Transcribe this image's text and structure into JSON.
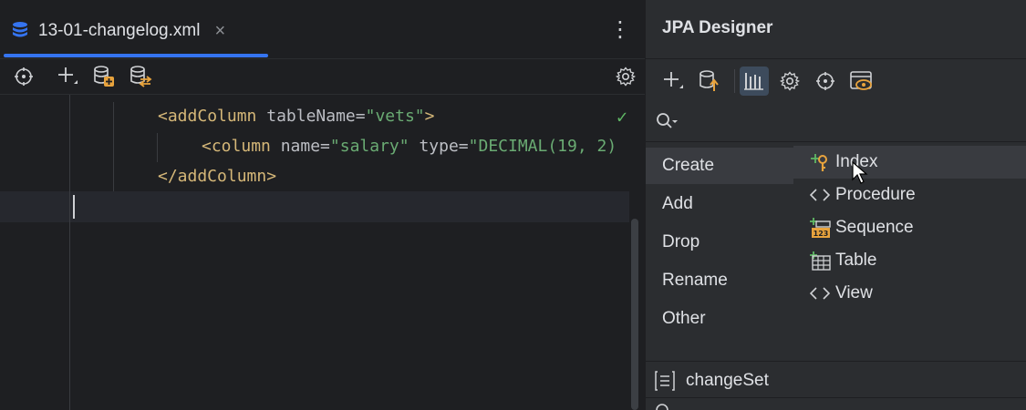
{
  "editor": {
    "tab": {
      "label": "13-01-changelog.xml",
      "close": "×"
    },
    "more_glyph": "⋮",
    "code": {
      "line1": {
        "open": "<",
        "tag": "addColumn",
        "attr": " tableName=",
        "val": "\"vets\"",
        "close": ">"
      },
      "line2": {
        "open": "<",
        "tag": "column",
        "attr1": " name=",
        "val1": "\"salary\"",
        "attr2": " type=",
        "val2": "\"DECIMAL(19, 2)"
      },
      "line3": {
        "text": "</addColumn>"
      }
    },
    "check_glyph": "✓"
  },
  "panel": {
    "title": "JPA Designer",
    "menu": [
      {
        "label": "Create"
      },
      {
        "label": "Add"
      },
      {
        "label": "Drop"
      },
      {
        "label": "Rename"
      },
      {
        "label": "Other"
      }
    ],
    "submenu": [
      {
        "label": "Index",
        "icon": "index-key-icon"
      },
      {
        "label": "Procedure",
        "icon": "code-brackets-icon"
      },
      {
        "label": "Sequence",
        "icon": "sequence-icon"
      },
      {
        "label": "Table",
        "icon": "table-icon"
      },
      {
        "label": "View",
        "icon": "code-brackets-icon"
      }
    ],
    "changeset": "changeSet"
  },
  "colors": {
    "accent": "#3574f0",
    "tag": "#d5b778",
    "value": "#6aab73",
    "check": "#5fb865",
    "icon_orange": "#e8a33d"
  }
}
